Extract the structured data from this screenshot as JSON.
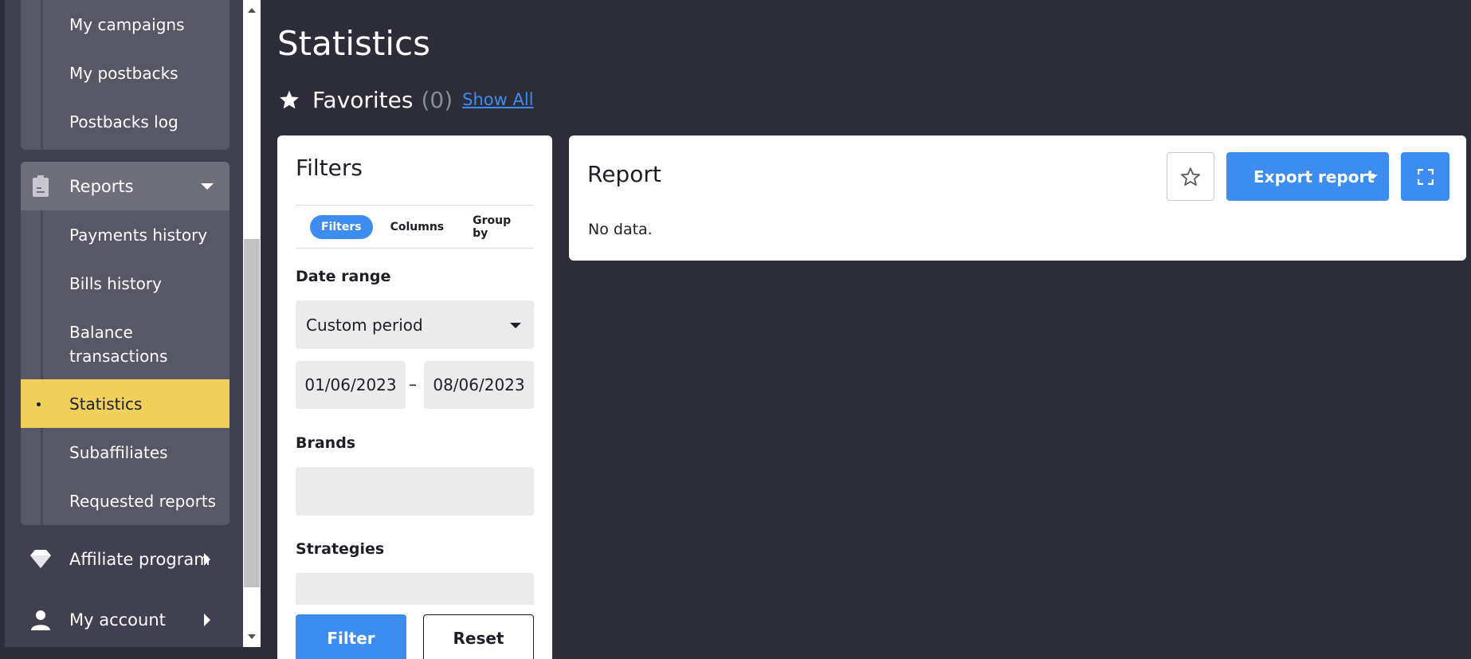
{
  "sidebar": {
    "top_group": {
      "items": [
        {
          "label": "My campaigns"
        },
        {
          "label": "My postbacks"
        },
        {
          "label": "Postbacks log"
        }
      ]
    },
    "reports": {
      "header_label": "Reports",
      "icon": "clipboard-icon",
      "items": [
        {
          "label": "Payments history"
        },
        {
          "label": "Bills history"
        },
        {
          "label": "Balance transactions"
        },
        {
          "label": "Statistics",
          "active": true
        },
        {
          "label": "Subaffiliates"
        },
        {
          "label": "Requested reports"
        }
      ]
    },
    "affiliate_program": {
      "label": "Affiliate program",
      "icon": "diamond-icon"
    },
    "my_account": {
      "label": "My account",
      "icon": "user-icon"
    }
  },
  "page": {
    "title": "Statistics"
  },
  "favorites": {
    "label": "Favorites",
    "count": "(0)",
    "show_all": "Show All"
  },
  "filters": {
    "title": "Filters",
    "tabs": [
      {
        "label": "Filters",
        "active": true
      },
      {
        "label": "Columns"
      },
      {
        "label": "Group by"
      }
    ],
    "date_range_label": "Date range",
    "date_range_value": "Custom period",
    "date_from": "01/06/2023",
    "date_separator": "–",
    "date_to": "08/06/2023",
    "brands_label": "Brands",
    "strategies_label": "Strategies",
    "filter_button": "Filter",
    "reset_button": "Reset"
  },
  "report": {
    "title": "Report",
    "empty_text": "No data.",
    "export_button": "Export report"
  },
  "colors": {
    "background": "#2d2c39",
    "accent_blue": "#3d8cf0",
    "active_yellow": "#f0d05a",
    "sidebar_group": "#585765"
  }
}
